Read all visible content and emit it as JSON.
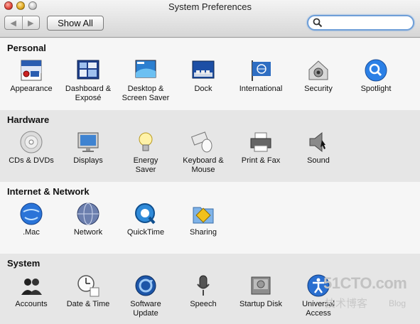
{
  "window": {
    "title": "System Preferences"
  },
  "toolbar": {
    "show_all_label": "Show All",
    "back_glyph": "◀",
    "forward_glyph": "▶",
    "search_placeholder": ""
  },
  "sections": [
    {
      "title": "Personal",
      "items": [
        {
          "label": "Appearance",
          "icon": "appearance-icon"
        },
        {
          "label": "Dashboard &\nExposé",
          "icon": "dashboard-expose-icon"
        },
        {
          "label": "Desktop &\nScreen Saver",
          "icon": "desktop-screensaver-icon"
        },
        {
          "label": "Dock",
          "icon": "dock-icon"
        },
        {
          "label": "International",
          "icon": "international-icon"
        },
        {
          "label": "Security",
          "icon": "security-icon"
        },
        {
          "label": "Spotlight",
          "icon": "spotlight-icon"
        }
      ]
    },
    {
      "title": "Hardware",
      "items": [
        {
          "label": "CDs & DVDs",
          "icon": "cds-dvds-icon"
        },
        {
          "label": "Displays",
          "icon": "displays-icon"
        },
        {
          "label": "Energy\nSaver",
          "icon": "energy-saver-icon"
        },
        {
          "label": "Keyboard &\nMouse",
          "icon": "keyboard-mouse-icon"
        },
        {
          "label": "Print & Fax",
          "icon": "print-fax-icon"
        },
        {
          "label": "Sound",
          "icon": "sound-icon"
        }
      ]
    },
    {
      "title": "Internet & Network",
      "items": [
        {
          "label": ".Mac",
          "icon": "dotmac-icon"
        },
        {
          "label": "Network",
          "icon": "network-icon"
        },
        {
          "label": "QuickTime",
          "icon": "quicktime-icon"
        },
        {
          "label": "Sharing",
          "icon": "sharing-icon"
        }
      ]
    },
    {
      "title": "System",
      "items": [
        {
          "label": "Accounts",
          "icon": "accounts-icon"
        },
        {
          "label": "Date & Time",
          "icon": "date-time-icon"
        },
        {
          "label": "Software\nUpdate",
          "icon": "software-update-icon"
        },
        {
          "label": "Speech",
          "icon": "speech-icon"
        },
        {
          "label": "Startup Disk",
          "icon": "startup-disk-icon"
        },
        {
          "label": "Universal\nAccess",
          "icon": "universal-access-icon"
        }
      ]
    }
  ],
  "watermark": {
    "logo": "51CTO.com",
    "sub": "技术博客",
    "blog": "Blog"
  },
  "colors": {
    "accent": "#6f9fd8",
    "section_white": "#f6f6f6",
    "section_gray": "#e6e6e6"
  }
}
